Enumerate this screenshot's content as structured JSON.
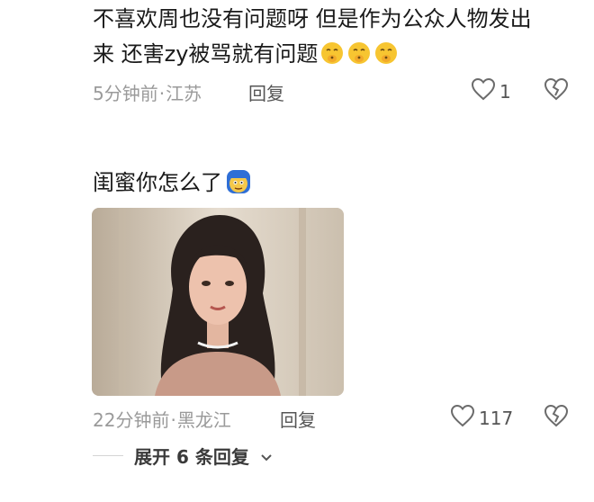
{
  "comment1": {
    "text_line1": "不喜欢周也没有问题呀 但是作为公众人物发出",
    "text_line2": "来 还害zy被骂就有问题",
    "emojis": [
      "shh-face-emoji",
      "shh-face-emoji",
      "shh-face-emoji"
    ],
    "time": "5分钟前",
    "location": "江苏",
    "reply_label": "回复",
    "like_count": "1"
  },
  "comment2": {
    "text": "闺蜜你怎么了",
    "emoji": "pixel-face-emoji",
    "time": "22分钟前",
    "location": "黑龙江",
    "reply_label": "回复",
    "like_count": "117"
  },
  "expand_replies": {
    "label": "展开 6 条回复"
  },
  "colors": {
    "meta_gray": "#9a9a9a",
    "text": "#1a1a1a",
    "icon_gray": "#6b6b6b"
  }
}
